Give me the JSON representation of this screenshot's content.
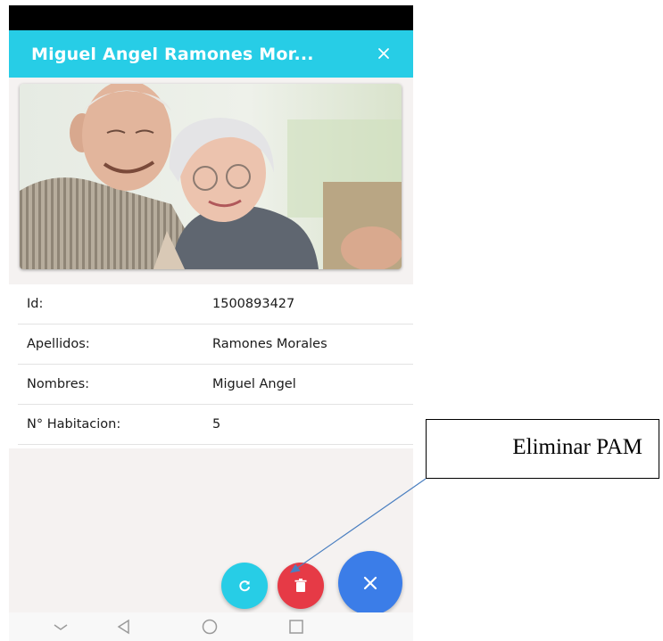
{
  "app_bar": {
    "title": "Miguel Angel Ramones Mor...",
    "close_icon": "close-icon",
    "color": "#27cde6"
  },
  "photo": {
    "description_icon": "profile-photo"
  },
  "details": [
    {
      "label": "Id:",
      "value": "1500893427"
    },
    {
      "label": "Apellidos:",
      "value": "Ramones Morales"
    },
    {
      "label": "Nombres:",
      "value": "Miguel Angel"
    },
    {
      "label": "N° Habitacion:",
      "value": "5"
    }
  ],
  "fabs": {
    "refresh": {
      "icon": "refresh-icon",
      "color": "#27cde6"
    },
    "delete": {
      "icon": "trash-icon",
      "color": "#e63a46"
    },
    "close": {
      "icon": "close-icon",
      "color": "#3b7de8"
    }
  },
  "nav_bar": {
    "icons": [
      "chevron-down-icon",
      "back-icon",
      "home-icon",
      "recents-icon"
    ]
  },
  "callout": {
    "text": "Eliminar PAM"
  }
}
